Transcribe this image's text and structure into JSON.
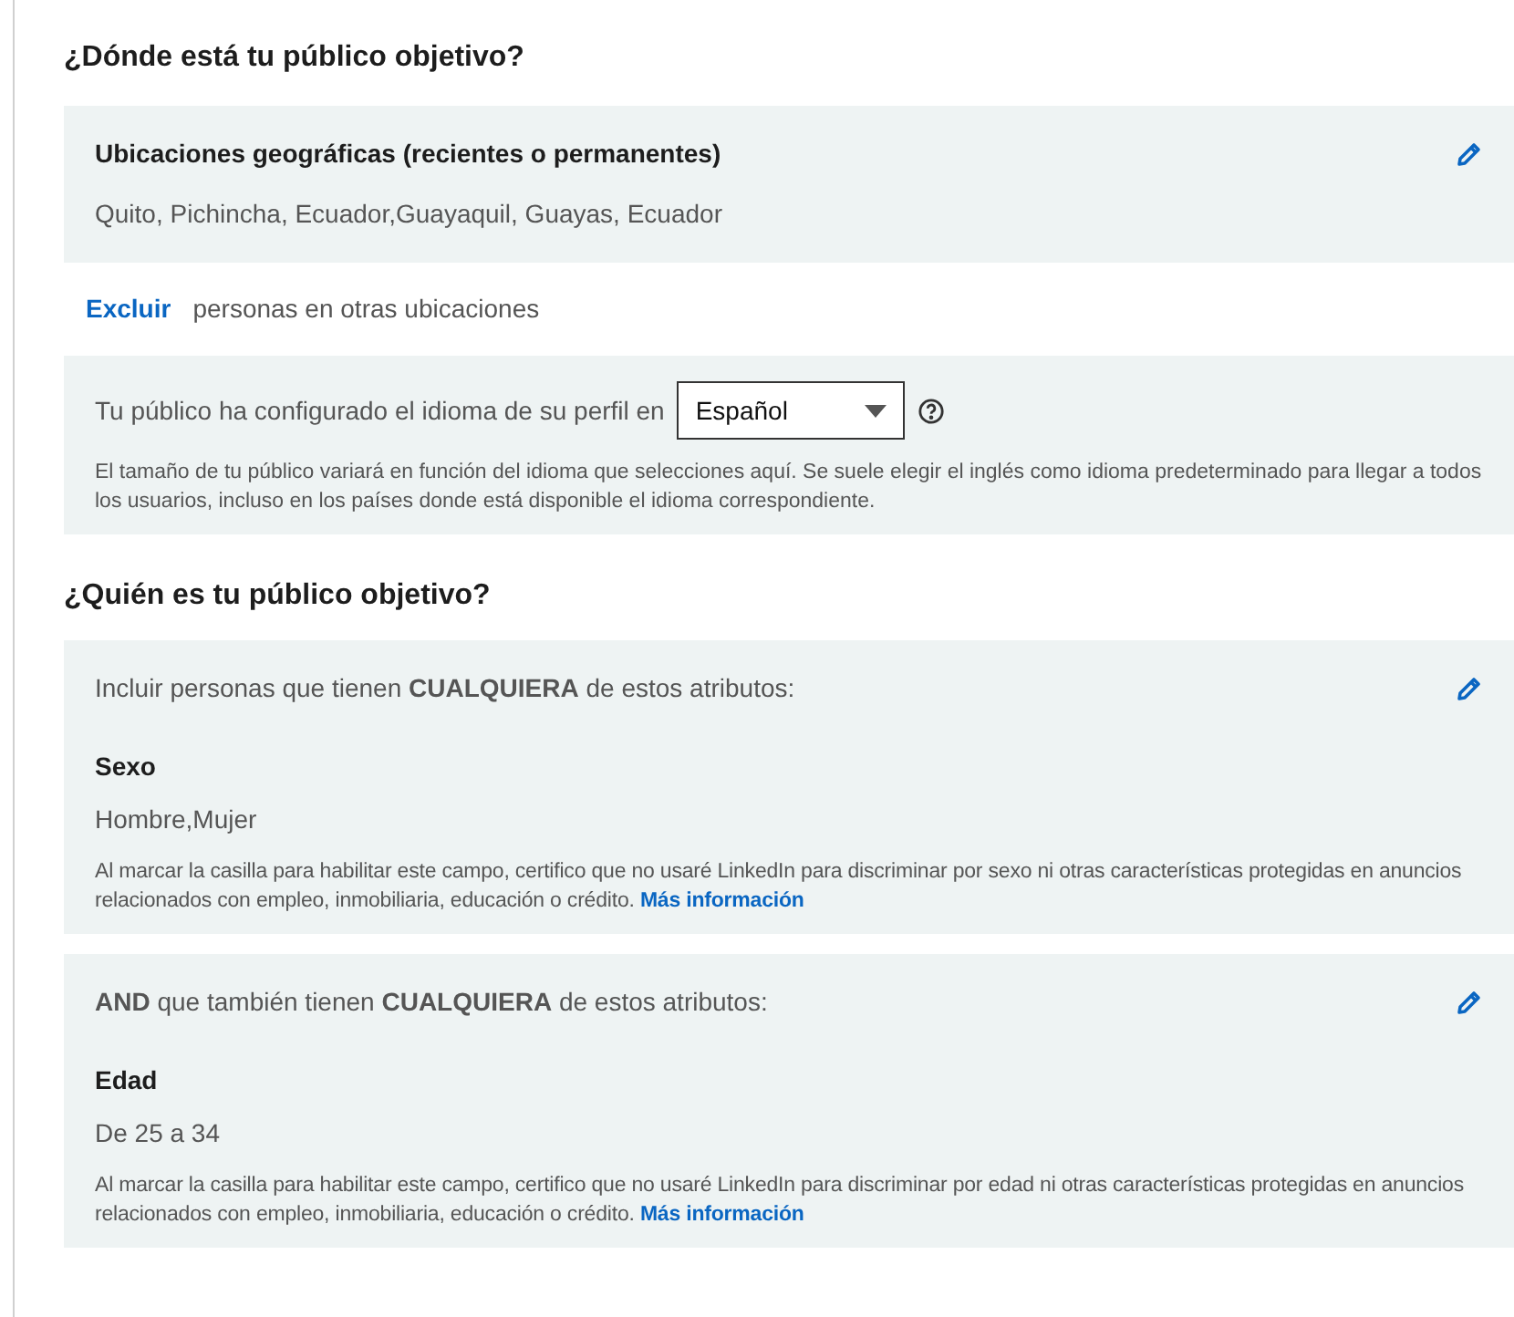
{
  "where": {
    "heading": "¿Dónde está tu público objetivo?",
    "locations": {
      "title": "Ubicaciones geográficas (recientes o permanentes)",
      "value": "Quito, Pichincha, Ecuador,Guayaquil, Guayas, Ecuador"
    },
    "exclude": {
      "link": "Excluir",
      "text": "personas en otras ubicaciones"
    },
    "language": {
      "label": "Tu público ha configurado el idioma de su perfil en",
      "selected_value": "Español",
      "help": "El tamaño de tu público variará en función del idioma que selecciones aquí. Se suele elegir el inglés como idioma predeterminado para llegar a todos los usuarios, incluso en los países donde está disponible el idioma correspondiente."
    }
  },
  "who": {
    "heading": "¿Quién es tu público objetivo?",
    "groups": [
      {
        "intro": "Incluir personas que tienen **CUALQUIERA** de estos atributos:",
        "attribute": "Sexo",
        "value": "Hombre,Mujer",
        "disclaimer": "Al marcar la casilla para habilitar este campo, certifico que no usaré LinkedIn para discriminar por sexo ni otras características protegidas en anuncios relacionados con empleo, inmobiliaria, educación o crédito.",
        "link": "Más información"
      },
      {
        "intro": "**AND** que también tienen **CUALQUIERA** de estos atributos:",
        "attribute": "Edad",
        "value": "De 25 a 34",
        "disclaimer": "Al marcar la casilla para habilitar este campo, certifico que no usaré LinkedIn para discriminar por edad ni otras características protegidas en anuncios relacionados con empleo, inmobiliaria, educación o crédito.",
        "link": "Más información"
      }
    ]
  }
}
